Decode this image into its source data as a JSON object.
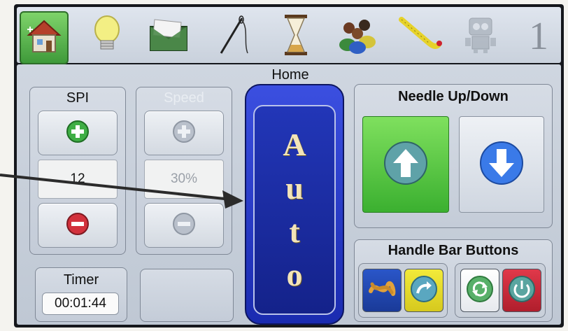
{
  "toolbar": {
    "icons": [
      "house-icon",
      "lightbulb-icon",
      "envelope-icon",
      "needle-thread-icon",
      "hourglass-icon",
      "people-icon",
      "measuring-tape-icon",
      "robot-icon"
    ],
    "page_number": "1"
  },
  "page": {
    "title": "Home"
  },
  "spi": {
    "label": "SPI",
    "value": "12"
  },
  "speed": {
    "label": "Speed",
    "value": "30%"
  },
  "auto": {
    "chars": [
      "A",
      "u",
      "t",
      "o"
    ]
  },
  "needle": {
    "label": "Needle Up/Down"
  },
  "handle_bar": {
    "label": "Handle Bar Buttons"
  },
  "timer": {
    "label": "Timer",
    "value": "00:01:44"
  },
  "colors": {
    "accent_blue": "#1a2bb0",
    "green": "#4cbf3c",
    "red": "#c72a35",
    "yellow": "#e6dc2a"
  }
}
